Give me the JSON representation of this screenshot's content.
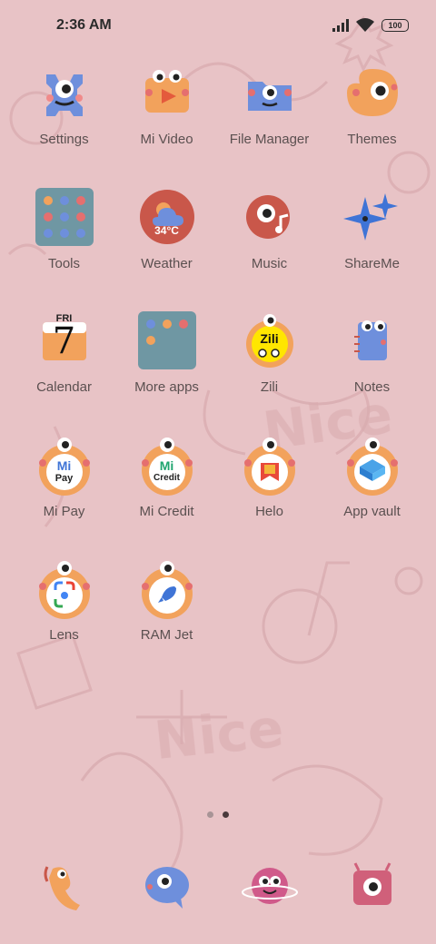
{
  "status_bar": {
    "time": "2:36 AM",
    "battery": "100",
    "icons": [
      "signal-icon",
      "wifi-icon",
      "battery-icon"
    ]
  },
  "apps": [
    {
      "label": "Settings",
      "icon": "settings-icon"
    },
    {
      "label": "Mi Video",
      "icon": "video-icon"
    },
    {
      "label": "File Manager",
      "icon": "folder-icon"
    },
    {
      "label": "Themes",
      "icon": "palette-icon"
    },
    {
      "label": "Tools",
      "icon": "tools-folder-icon"
    },
    {
      "label": "Weather",
      "icon": "weather-icon",
      "badge": "34°C"
    },
    {
      "label": "Music",
      "icon": "music-icon"
    },
    {
      "label": "ShareMe",
      "icon": "sparkle-icon"
    },
    {
      "label": "Calendar",
      "icon": "calendar-icon",
      "badge_day": "FRI",
      "badge_date": "7"
    },
    {
      "label": "More apps",
      "icon": "more-apps-folder-icon"
    },
    {
      "label": "Zili",
      "icon": "zili-icon",
      "badge": "Zili"
    },
    {
      "label": "Notes",
      "icon": "notes-icon"
    },
    {
      "label": "Mi Pay",
      "icon": "mi-pay-icon",
      "badge_top": "Mi",
      "badge_bottom": "Pay"
    },
    {
      "label": "Mi Credit",
      "icon": "mi-credit-icon",
      "badge_top": "Mi",
      "badge_bottom": "Credit"
    },
    {
      "label": "Helo",
      "icon": "helo-icon"
    },
    {
      "label": "App vault",
      "icon": "app-vault-icon"
    },
    {
      "label": "Lens",
      "icon": "lens-icon"
    },
    {
      "label": "RAM Jet",
      "icon": "rocket-icon"
    }
  ],
  "page_indicator": {
    "count": 2,
    "active": 2
  },
  "dock": [
    {
      "name": "phone-icon"
    },
    {
      "name": "messages-icon"
    },
    {
      "name": "browser-icon"
    },
    {
      "name": "camera-icon"
    }
  ],
  "colors": {
    "background": "#e8c3c6",
    "icon_orange": "#f2a25c",
    "icon_blue": "#6e8fdc",
    "icon_red": "#c9574a",
    "label_text": "#5b5050"
  }
}
